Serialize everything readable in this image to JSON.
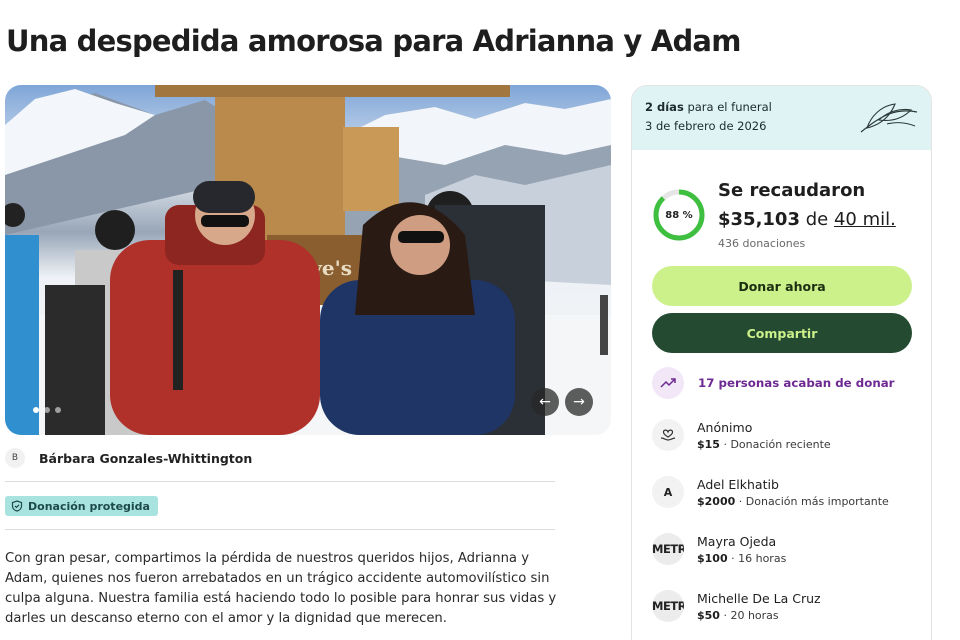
{
  "page": {
    "title": "Una despedida amorosa para Adrianna y Adam"
  },
  "hero": {
    "sign_text": "Dave's R",
    "prev_icon": "arrow-left-icon",
    "next_icon": "arrow-right-icon",
    "slide_count": 3,
    "active_slide": 1
  },
  "organizer": {
    "initial": "B",
    "name": "Bárbara Gonzales-Whittington"
  },
  "badge": {
    "label": "Donación protegida",
    "icon": "shield-icon"
  },
  "story": {
    "text": "Con gran pesar, compartimos la pérdida de nuestros queridos hijos, Adrianna y Adam, quienes nos fueron arrebatados en un trágico accidente automovilístico sin culpa alguna. Nuestra familia está haciendo todo lo posible para honrar sus vidas y darles un descanso eterno con el amor y la dignidad que merecen."
  },
  "side_card": {
    "days_bold": "2 días",
    "days_rest": " para el funeral",
    "date": "3 de febrero de 2026",
    "progress_percent": 88,
    "progress_label": "88 %",
    "raised_label": "Se recaudaron",
    "raised_amount": "$35,103",
    "raised_of": " de ",
    "goal": "40 mil.",
    "donation_count": "436 donaciones",
    "donate_button": "Donar ahora",
    "share_button": "Compartir",
    "recent_text": "17 personas acaban de donar",
    "colors": {
      "accent_green": "#ccf08a",
      "dark_green": "#254a32",
      "ring_green": "#3fbf3f",
      "purple": "#6e2a92",
      "top_band": "#dff3f5"
    }
  },
  "donors": [
    {
      "avatar": "",
      "avatar_icon": "heart-hand-icon",
      "name": "Anónimo",
      "amount": "$15",
      "detail": " · Donación reciente"
    },
    {
      "avatar": "A",
      "name": "Adel Elkhatib",
      "amount": "$2000",
      "detail": " · Donación más importante"
    },
    {
      "avatar": "METRO",
      "name": "Mayra Ojeda",
      "amount": "$100",
      "detail": " · 16 horas"
    },
    {
      "avatar": "METRO",
      "name": "Michelle De La Cruz",
      "amount": "$50",
      "detail": " · 20 horas"
    }
  ]
}
